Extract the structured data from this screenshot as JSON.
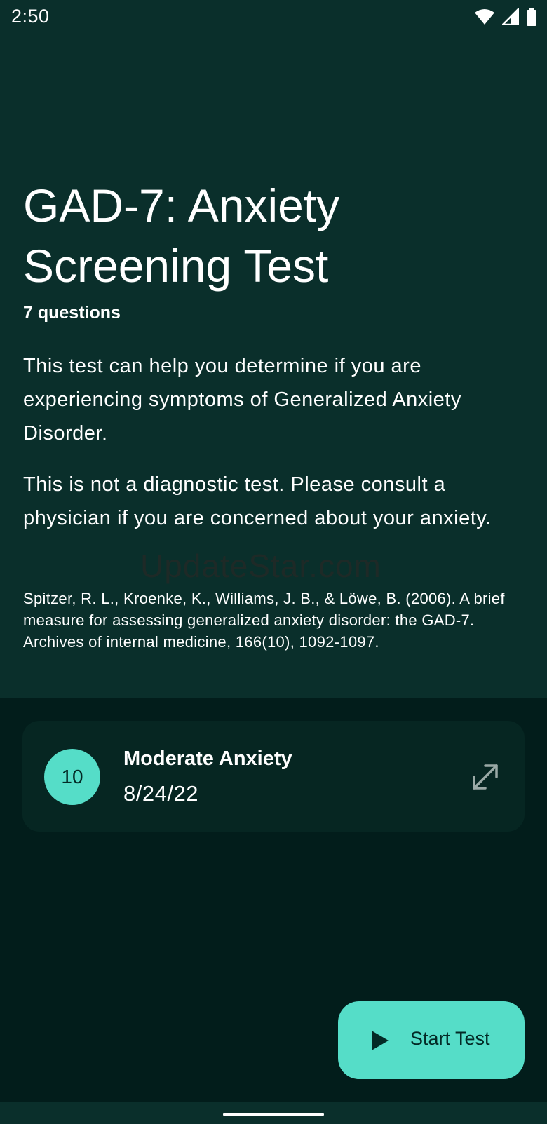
{
  "status_bar": {
    "time": "2:50",
    "icons": [
      "wifi-icon",
      "cellular-signal-icon",
      "battery-icon"
    ]
  },
  "test": {
    "title": "GAD-7: Anxiety Screening Test",
    "subtitle": "7 questions",
    "description": "This test can help you determine if you are experiencing symptoms of Generalized Anxiety Disorder.",
    "disclaimer": "This is not a diagnostic test. Please consult a physician if you are concerned about your anxiety.",
    "citation": "Spitzer, R. L., Kroenke, K., Williams, J. B., & Löwe, B. (2006). A brief measure for assessing generalized anxiety disorder: the GAD-7. Archives of internal medicine, 166(10), 1092-1097."
  },
  "watermark": "UpdateStar.com",
  "results": [
    {
      "score": "10",
      "label": "Moderate Anxiety",
      "date": "8/24/22",
      "action_icon": "expand-icon"
    }
  ],
  "fab": {
    "label": "Start Test",
    "icon": "play-icon"
  },
  "colors": {
    "header_bg": "#0a2f2b",
    "page_bg": "#021d1b",
    "card_bg": "#062622",
    "accent": "#55ddc8"
  }
}
